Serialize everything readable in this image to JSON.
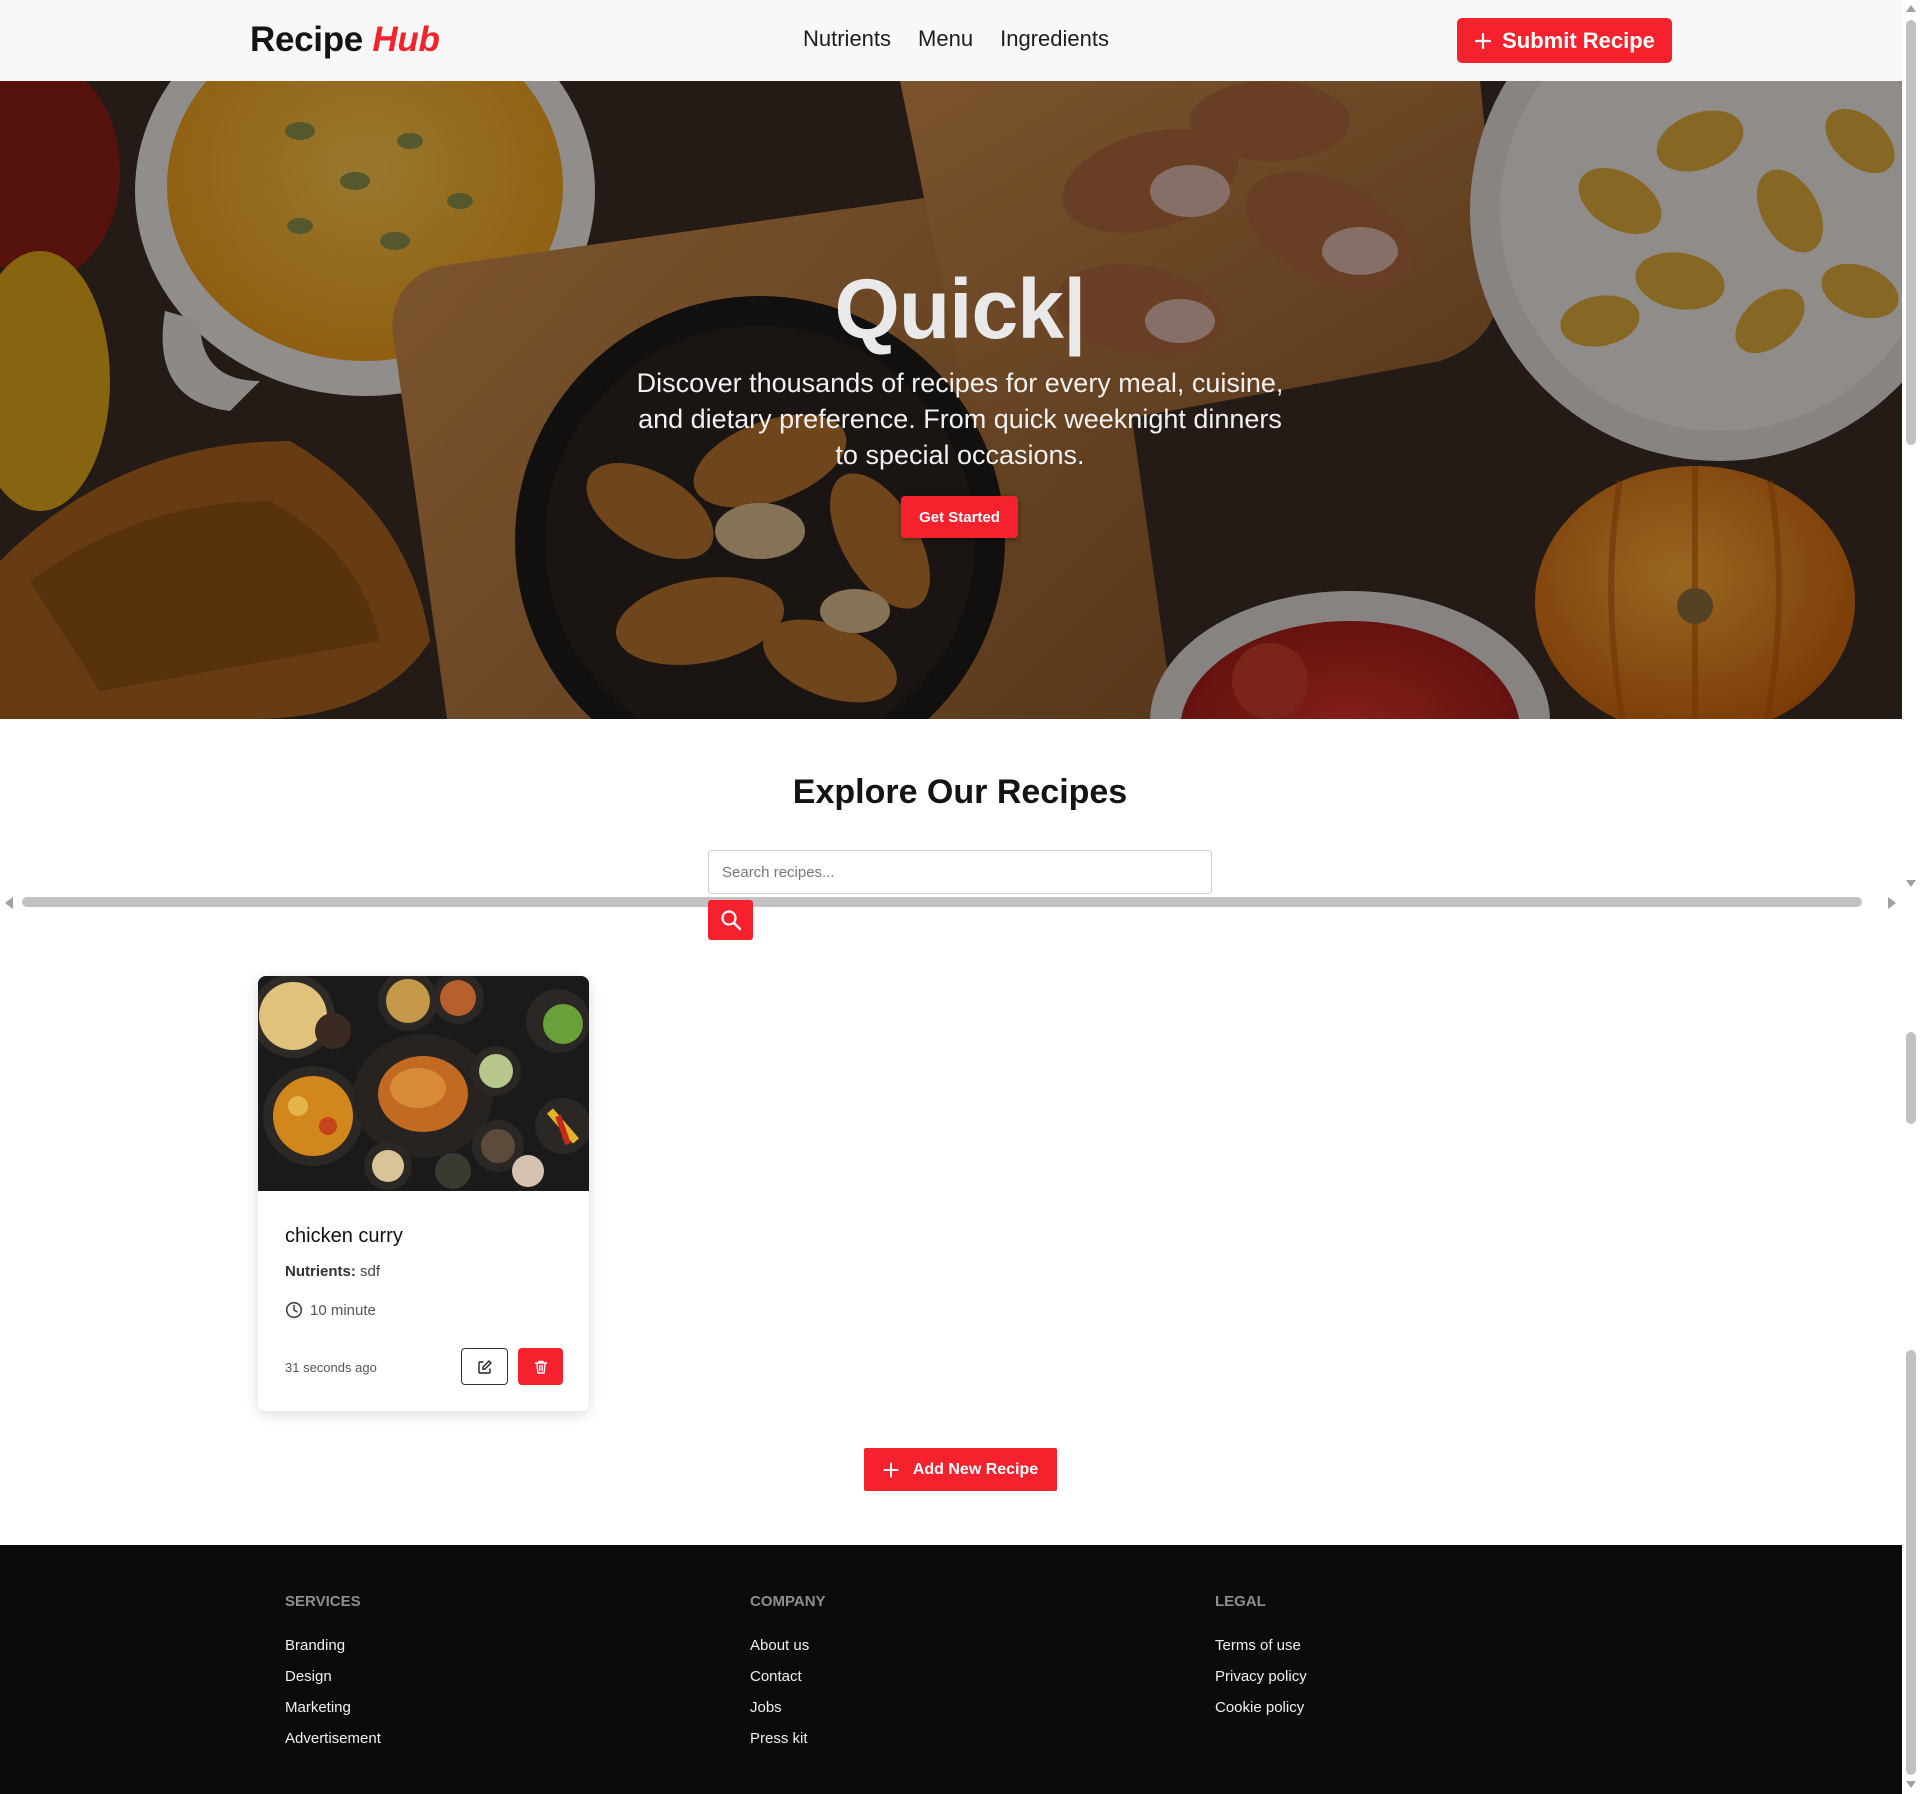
{
  "brand": {
    "name": "Recipe",
    "accent": "Hub"
  },
  "nav": {
    "links": [
      "Nutrients",
      "Menu",
      "Ingredients"
    ]
  },
  "submit_button": {
    "label": "Submit Recipe",
    "icon": "plus-icon"
  },
  "hero": {
    "title": "Quick|",
    "subtitle": "Discover thousands of recipes for every meal, cuisine, and dietary preference. From quick weeknight dinners to special occasions.",
    "cta_label": "Get Started"
  },
  "explore": {
    "title": "Explore Our Recipes",
    "search_placeholder": "Search recipes...",
    "search_icon": "search-icon"
  },
  "recipes": [
    {
      "title": "chicken curry",
      "nutrients_label": "Nutrients:",
      "nutrients_value": "sdf",
      "time": "10 minute",
      "ago": "31 seconds ago"
    }
  ],
  "add_button": {
    "label": "Add New Recipe",
    "icon": "plus-icon"
  },
  "footer": {
    "services": {
      "heading": "SERVICES",
      "links": [
        "Branding",
        "Design",
        "Marketing",
        "Advertisement"
      ]
    },
    "company": {
      "heading": "COMPANY",
      "links": [
        "About us",
        "Contact",
        "Jobs",
        "Press kit"
      ]
    },
    "legal": {
      "heading": "LEGAL",
      "links": [
        "Terms of use",
        "Privacy policy",
        "Cookie policy"
      ]
    }
  },
  "colors": {
    "accent": "#f5222d",
    "footer_bg": "#0b0b0e",
    "nav_bg": "#f8f8f8"
  }
}
